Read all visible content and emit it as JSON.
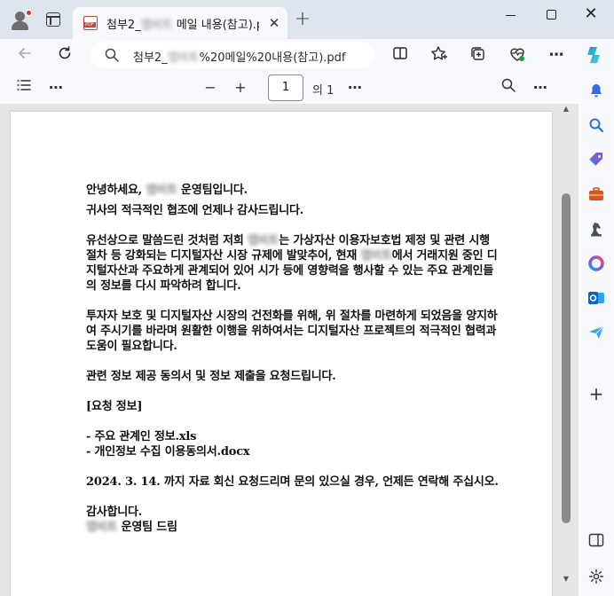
{
  "browser": {
    "tab_title_prefix": "첨부2_",
    "tab_title_blur": "앱비트",
    "tab_title_suffix": " 메일 내용(참고).pdf",
    "tab_close": "✕",
    "new_tab": "+",
    "url_prefix": "첨부2_",
    "url_blur": "앱비트",
    "url_suffix": "%20메일%20내용(참고).pdf",
    "win_close": "✕"
  },
  "pdf_toolbar": {
    "zoom_out": "−",
    "zoom_in": "+",
    "page_current": "1",
    "page_of": "의 1",
    "more": "⋯"
  },
  "document": {
    "greeting_pre": "안녕하세요, ",
    "blur1": "앱비트",
    "greeting_post": " 운영팀입니다.",
    "line2": "귀사의 적극적인 협조에 언제나 감사드립니다.",
    "p2_pre": "유선상으로 말씀드린 것처럼 저희 ",
    "blur2": "앱비트",
    "p2_mid1": "는 가상자산 이용자보호법 제정 및 관련 시행 절차 등 강화되는 디지털자산 시장 규제에 발맞추어, 현재 ",
    "blur3": "앱비트",
    "p2_mid2": "에서 거래지원 중인 디지털자산과 주요하게 관계되어 있어 시가 등에 영향력을 행사할 수 있는 주요 관계인들의 정보를 다시 파악하려 합니다.",
    "p3": "투자자 보호 및 디지털자산 시장의 건전화를 위해, 위 절차를 마련하게 되었음을 양지하여 주시기를 바라며 원활한 이행을 위하여서는 디지털자산 프로젝트의 적극적인 협력과 도움이 필요합니다.",
    "p4": "관련 정보 제공 동의서 및 정보 제출을 요청드립니다.",
    "p5": "[요청 정보]",
    "item1": "- 주요 관계인 정보.xls",
    "item2": "- 개인정보 수집 이용동의서.docx",
    "p7": "2024. 3. 14. 까지 자료 회신 요청드리며 문의 있으실 경우, 언제든 연락해 주십시오.",
    "closing": "감사합니다.",
    "blur4": "앱비트",
    "sign_post": " 운영팀 드림"
  },
  "colors": {
    "accent": "#0067c0",
    "pdf_red": "#c4463a",
    "chrome_bg": "#dfe5ee",
    "toolbar_bg": "#f7f9fc"
  },
  "icons": {
    "sidebar": [
      "bell-icon",
      "search-icon",
      "tag-icon",
      "toolbox-icon",
      "chess-icon",
      "office-icon",
      "outlook-icon",
      "send-icon",
      "add-icon",
      "split-screen-icon",
      "settings-icon"
    ]
  }
}
